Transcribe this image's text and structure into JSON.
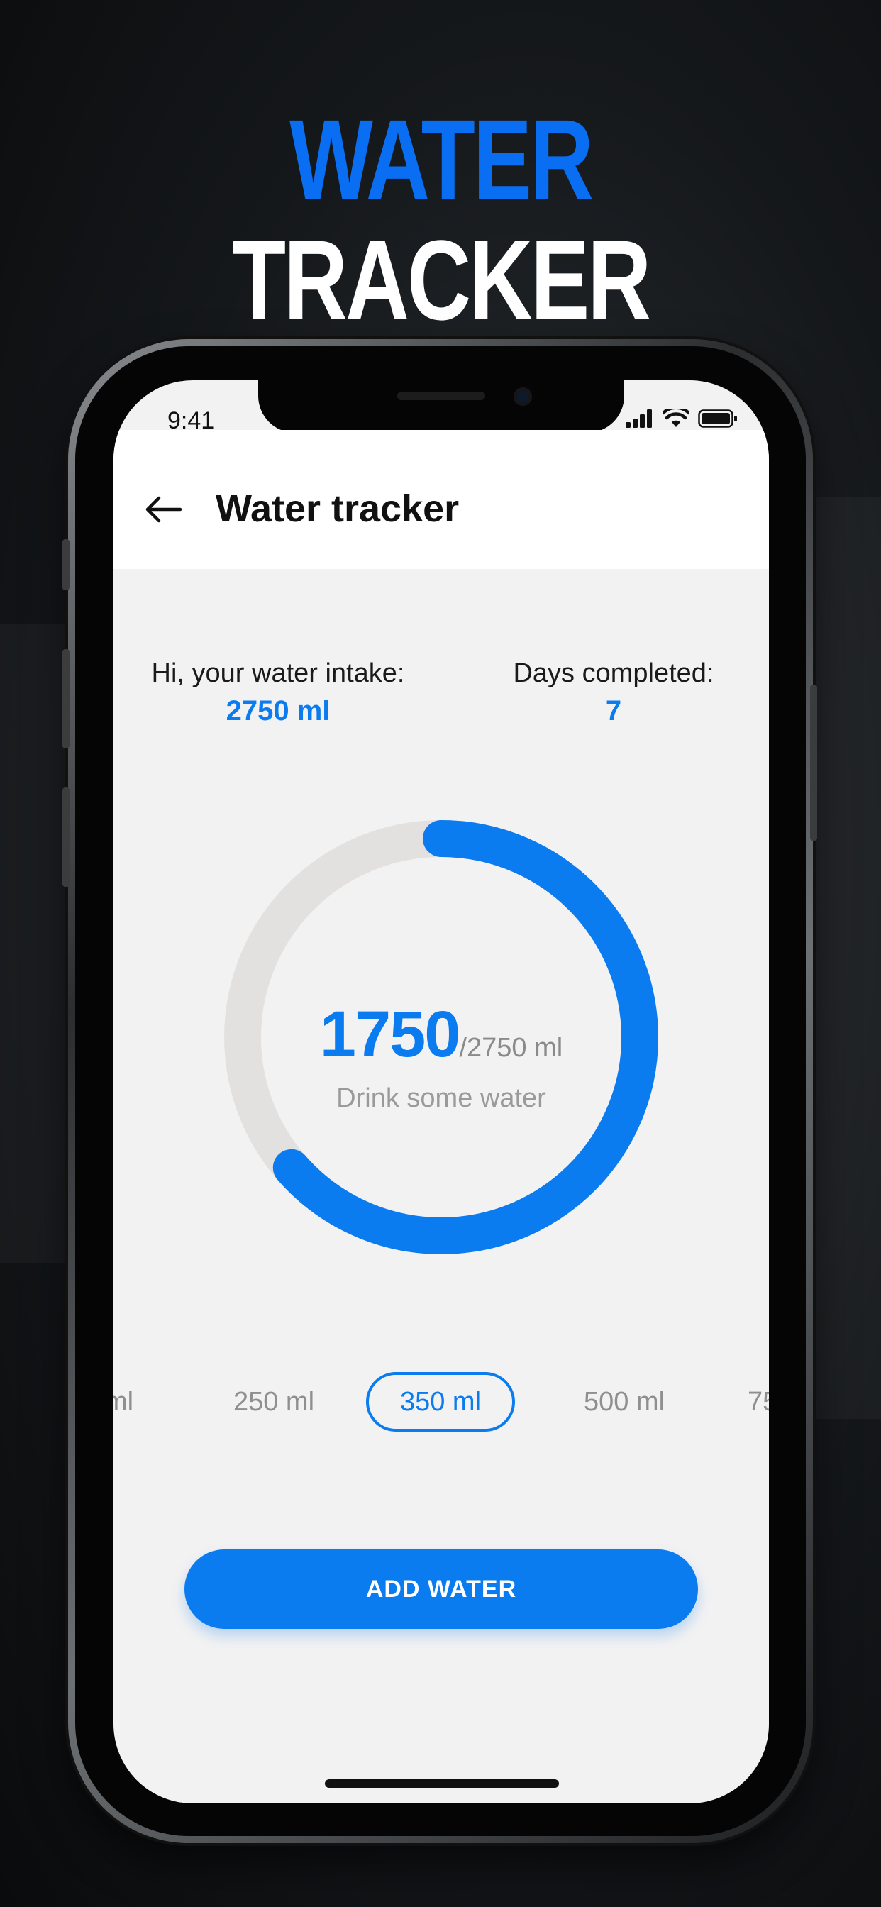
{
  "headline": {
    "word1": "WATER",
    "word2": "TRACKER"
  },
  "status_bar": {
    "time": "9:41"
  },
  "app_bar": {
    "title": "Water tracker"
  },
  "stats": {
    "intake_label": "Hi, your water intake:",
    "intake_value": "2750 ml",
    "days_label": "Days completed:",
    "days_value": "7"
  },
  "progress": {
    "current": "1750",
    "total_text": "/2750 ml",
    "fraction": 0.636,
    "message": "Drink some water"
  },
  "amounts": [
    {
      "label": "ml"
    },
    {
      "label": "250 ml"
    },
    {
      "label": "350 ml",
      "selected": true
    },
    {
      "label": "500 ml"
    },
    {
      "label": "75"
    }
  ],
  "add_button": {
    "label": "ADD WATER"
  },
  "colors": {
    "accent": "#0a7cf0",
    "track": "#e3e1e0",
    "screen_bg": "#f2f2f2"
  }
}
